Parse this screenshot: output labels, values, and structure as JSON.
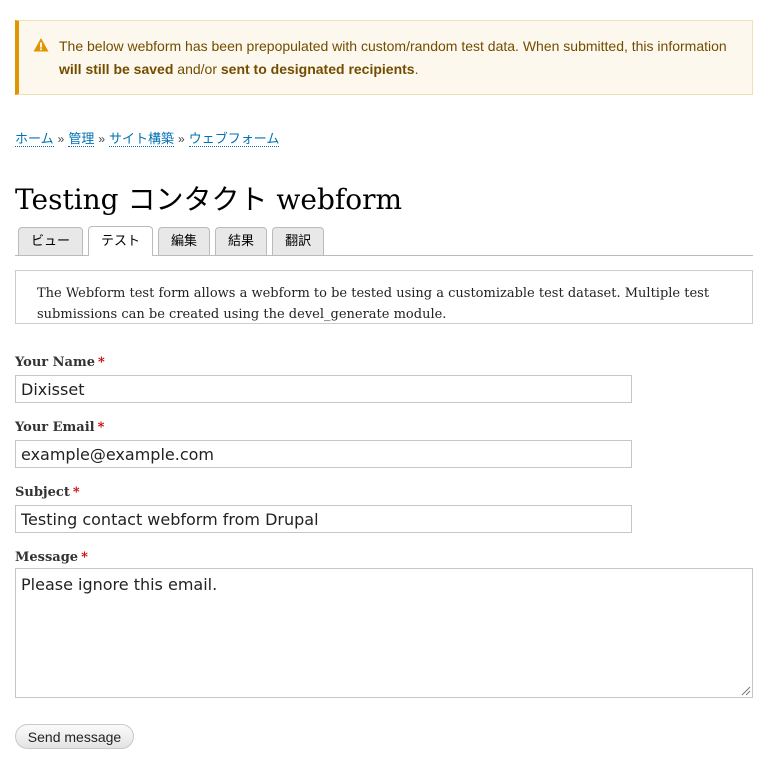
{
  "message": {
    "icon": "warning-icon",
    "text_1": "The below webform has been prepopulated with custom/random test data. When submitted, this information ",
    "strong_1": "will still be saved",
    "text_2": " and/or ",
    "strong_2": "sent to designated recipients",
    "text_3": "."
  },
  "breadcrumb": {
    "items": [
      "ホーム",
      "管理",
      "サイト構築",
      "ウェブフォーム"
    ],
    "separator": "»"
  },
  "page_title": "Testing コンタクト webform",
  "tabs": [
    {
      "label": "ビュー"
    },
    {
      "label": "テスト",
      "active": true
    },
    {
      "label": "編集"
    },
    {
      "label": "結果"
    },
    {
      "label": "翻訳"
    }
  ],
  "description": "The Webform test form allows a webform to be tested using a customizable test dataset. Multiple test submissions can be created using the devel_generate module.",
  "form": {
    "required_marker": "*",
    "name": {
      "label": "Your Name",
      "value": "Dixisset"
    },
    "email": {
      "label": "Your Email",
      "value": "example@example.com"
    },
    "subject": {
      "label": "Subject",
      "value": "Testing contact webform from Drupal"
    },
    "message": {
      "label": "Message",
      "value": "Please ignore this email."
    },
    "submit_label": "Send message"
  },
  "colors": {
    "warning_accent": "#e09600",
    "warning_background": "#fdf8ed",
    "link": "#0071b3",
    "required": "#cc0000"
  }
}
